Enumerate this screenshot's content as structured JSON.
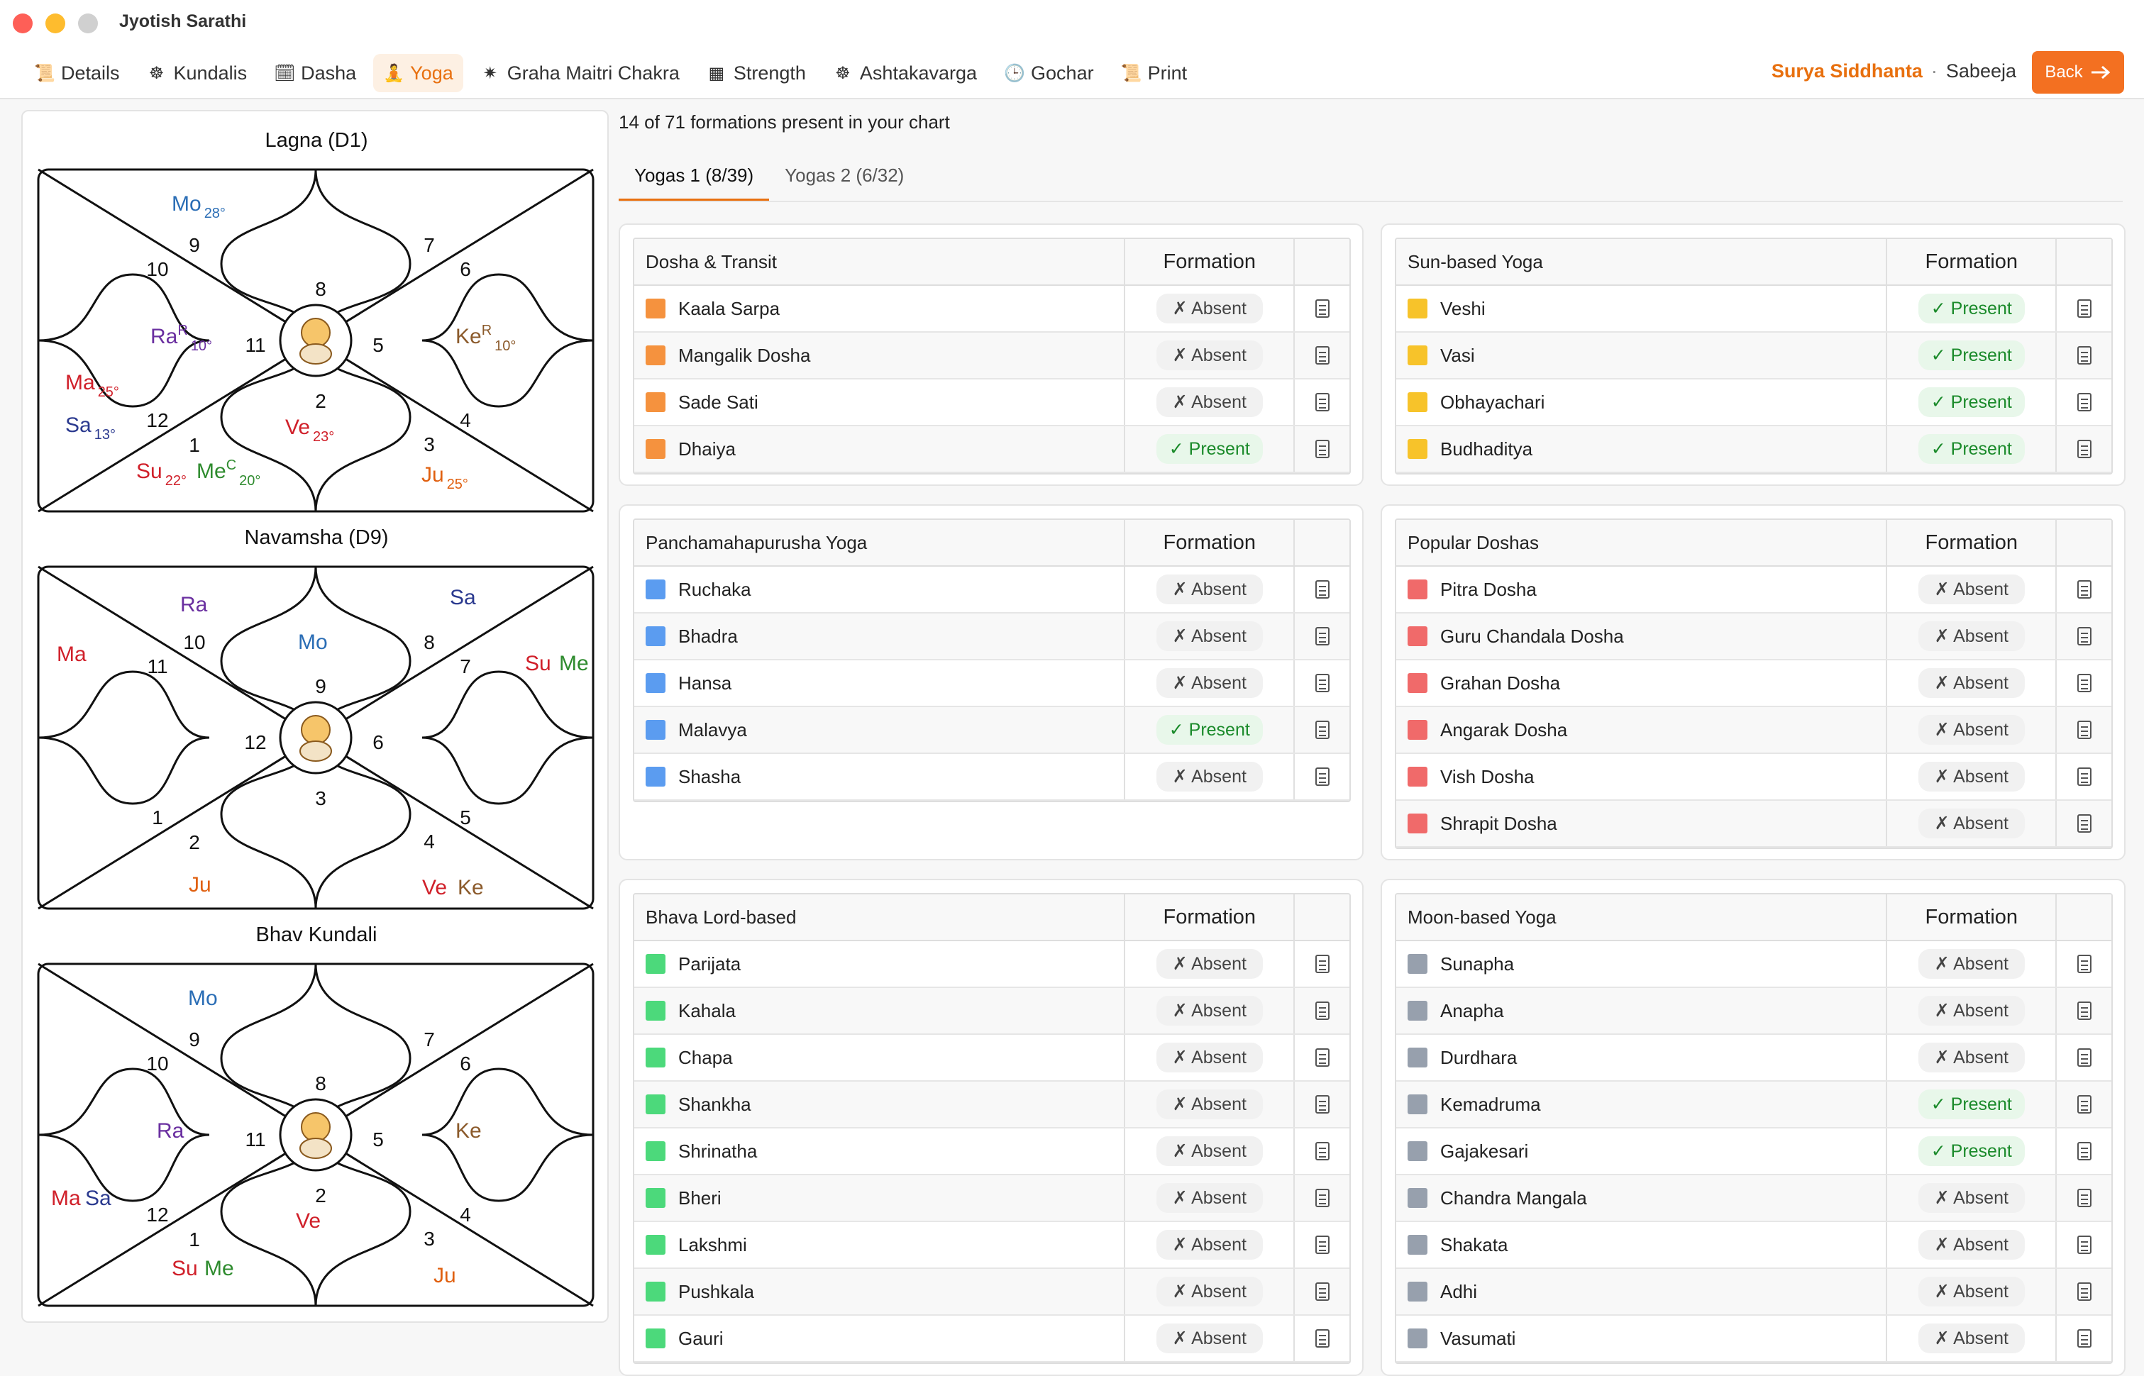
{
  "app": {
    "title": "Jyotish Sarathi"
  },
  "nav": [
    {
      "label": "Details",
      "icon": "details-icon",
      "glyph": "📜"
    },
    {
      "label": "Kundalis",
      "icon": "kundali-wheel-icon",
      "glyph": "☸"
    },
    {
      "label": "Dasha",
      "icon": "dasha-icon",
      "glyph": "🗓"
    },
    {
      "label": "Yoga",
      "icon": "yoga-icon",
      "glyph": "🧘"
    },
    {
      "label": "Graha Maitri Chakra",
      "icon": "graha-maitri-icon",
      "glyph": "✷"
    },
    {
      "label": "Strength",
      "icon": "strength-icon",
      "glyph": "▦"
    },
    {
      "label": "Ashtakavarga",
      "icon": "ashtakavarga-icon",
      "glyph": "☸"
    },
    {
      "label": "Gochar",
      "icon": "clock-icon",
      "glyph": "🕒"
    },
    {
      "label": "Print",
      "icon": "print-scroll-icon",
      "glyph": "📜"
    }
  ],
  "header": {
    "system": "Surya Siddhanta",
    "separator": "·",
    "variant": "Sabeeja",
    "back": "Back",
    "back_icon": "arrow-right-icon"
  },
  "charts": {
    "lagna": {
      "title": "Lagna (D1)",
      "houses": [
        "8",
        "7",
        "6",
        "5",
        "4",
        "3",
        "2",
        "1",
        "12",
        "11",
        "10",
        "9"
      ],
      "planets": [
        {
          "text": "Mo",
          "deg": "28°",
          "color": "#2a6db5"
        },
        {
          "text": "Ra",
          "sup": "R",
          "deg": "10°",
          "color": "#6a2fa0"
        },
        {
          "text": "Ke",
          "sup": "R",
          "deg": "10°",
          "color": "#8b5a2b"
        },
        {
          "text": "Ma",
          "deg": "25°",
          "color": "#d0202a"
        },
        {
          "text": "Sa",
          "deg": "13°",
          "color": "#2b3a8f"
        },
        {
          "text": "Ve",
          "deg": "23°",
          "color": "#d0202a"
        },
        {
          "text": "Su",
          "deg": "22°",
          "color": "#d0202a"
        },
        {
          "text": "Me",
          "sup": "C",
          "deg": "20°",
          "color": "#2e8b2e"
        },
        {
          "text": "Ju",
          "deg": "25°",
          "color": "#e06010"
        }
      ]
    },
    "navamsha": {
      "title": "Navamsha (D9)",
      "houses": [
        "9",
        "8",
        "7",
        "6",
        "5",
        "4",
        "3",
        "2",
        "1",
        "12",
        "11",
        "10"
      ],
      "planets": [
        {
          "text": "Ra",
          "color": "#6a2fa0"
        },
        {
          "text": "Sa",
          "color": "#2b3a8f"
        },
        {
          "text": "Mo",
          "color": "#2a6db5"
        },
        {
          "text": "Ma",
          "color": "#d0202a"
        },
        {
          "text": "Su",
          "color": "#d0202a"
        },
        {
          "text": "Me",
          "color": "#2e8b2e"
        },
        {
          "text": "Ju",
          "color": "#e06010"
        },
        {
          "text": "Ve",
          "color": "#d0202a"
        },
        {
          "text": "Ke",
          "color": "#8b5a2b"
        }
      ]
    },
    "bhav": {
      "title": "Bhav Kundali",
      "houses": [
        "8",
        "7",
        "6",
        "5",
        "4",
        "3",
        "2",
        "1",
        "12",
        "11",
        "10",
        "9"
      ],
      "planets": [
        {
          "text": "Mo",
          "color": "#2a6db5"
        },
        {
          "text": "Ra",
          "color": "#6a2fa0"
        },
        {
          "text": "Ke",
          "color": "#8b5a2b"
        },
        {
          "text": "Ma",
          "color": "#d0202a"
        },
        {
          "text": "Sa",
          "color": "#2b3a8f"
        },
        {
          "text": "Ve",
          "color": "#d0202a"
        },
        {
          "text": "Su",
          "color": "#d0202a"
        },
        {
          "text": "Me",
          "color": "#2e8b2e"
        },
        {
          "text": "Ju",
          "color": "#e06010"
        }
      ]
    }
  },
  "summary": "14 of 71 formations present in your chart",
  "tabs": [
    "Yogas 1 (8/39)",
    "Yogas 2 (6/32)"
  ],
  "formation_header": "Formation",
  "present_label": "✓ Present",
  "absent_label": "✗ Absent",
  "tables": [
    {
      "title": "Dosha & Transit",
      "color": "#f5923e",
      "rows": [
        [
          "Kaala Sarpa",
          false
        ],
        [
          "Mangalik Dosha",
          false
        ],
        [
          "Sade Sati",
          false
        ],
        [
          "Dhaiya",
          true
        ]
      ]
    },
    {
      "title": "Sun-based Yoga",
      "color": "#f7c32a",
      "rows": [
        [
          "Veshi",
          true
        ],
        [
          "Vasi",
          true
        ],
        [
          "Obhayachari",
          true
        ],
        [
          "Budhaditya",
          true
        ]
      ]
    },
    {
      "title": "Panchamahapurusha Yoga",
      "color": "#5b9cf0",
      "rows": [
        [
          "Ruchaka",
          false
        ],
        [
          "Bhadra",
          false
        ],
        [
          "Hansa",
          false
        ],
        [
          "Malavya",
          true
        ],
        [
          "Shasha",
          false
        ]
      ]
    },
    {
      "title": "Popular Doshas",
      "color": "#f06a6a",
      "rows": [
        [
          "Pitra Dosha",
          false
        ],
        [
          "Guru Chandala Dosha",
          false
        ],
        [
          "Grahan Dosha",
          false
        ],
        [
          "Angarak Dosha",
          false
        ],
        [
          "Vish Dosha",
          false
        ],
        [
          "Shrapit Dosha",
          false
        ]
      ]
    },
    {
      "title": "Bhava Lord-based",
      "color": "#4cd97b",
      "rows": [
        [
          "Parijata",
          false
        ],
        [
          "Kahala",
          false
        ],
        [
          "Chapa",
          false
        ],
        [
          "Shankha",
          false
        ],
        [
          "Shrinatha",
          false
        ],
        [
          "Bheri",
          false
        ],
        [
          "Lakshmi",
          false
        ],
        [
          "Pushkala",
          false
        ],
        [
          "Gauri",
          false
        ]
      ]
    },
    {
      "title": "Moon-based Yoga",
      "color": "#97a0ad",
      "rows": [
        [
          "Sunapha",
          false
        ],
        [
          "Anapha",
          false
        ],
        [
          "Durdhara",
          false
        ],
        [
          "Kemadruma",
          true
        ],
        [
          "Gajakesari",
          true
        ],
        [
          "Chandra Mangala",
          false
        ],
        [
          "Shakata",
          false
        ],
        [
          "Adhi",
          false
        ],
        [
          "Vasumati",
          false
        ]
      ]
    }
  ]
}
